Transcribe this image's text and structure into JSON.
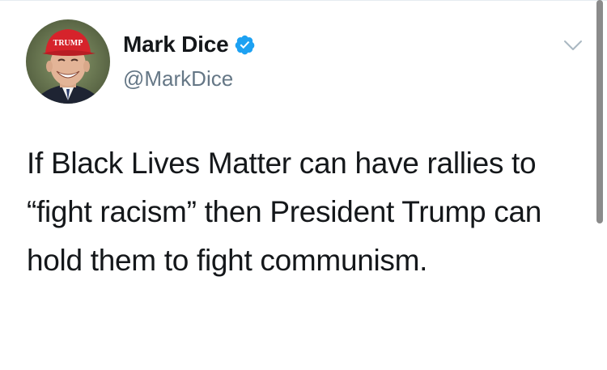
{
  "tweet": {
    "author": {
      "display_name": "Mark Dice",
      "handle": "@MarkDice",
      "verified": true,
      "avatar_hat_text": "TRUMP"
    },
    "text": "If Black Lives Matter can have rallies to “fight racism” then President Trump can hold them to fight communism.",
    "menu_icon": "chevron-down-icon",
    "verified_icon": "verified-badge-icon"
  },
  "colors": {
    "text_primary": "#14171a",
    "text_secondary": "#657786",
    "verified_blue": "#1da1f2",
    "hat_red": "#d6232b",
    "caret_gray": "#aab8c2"
  }
}
